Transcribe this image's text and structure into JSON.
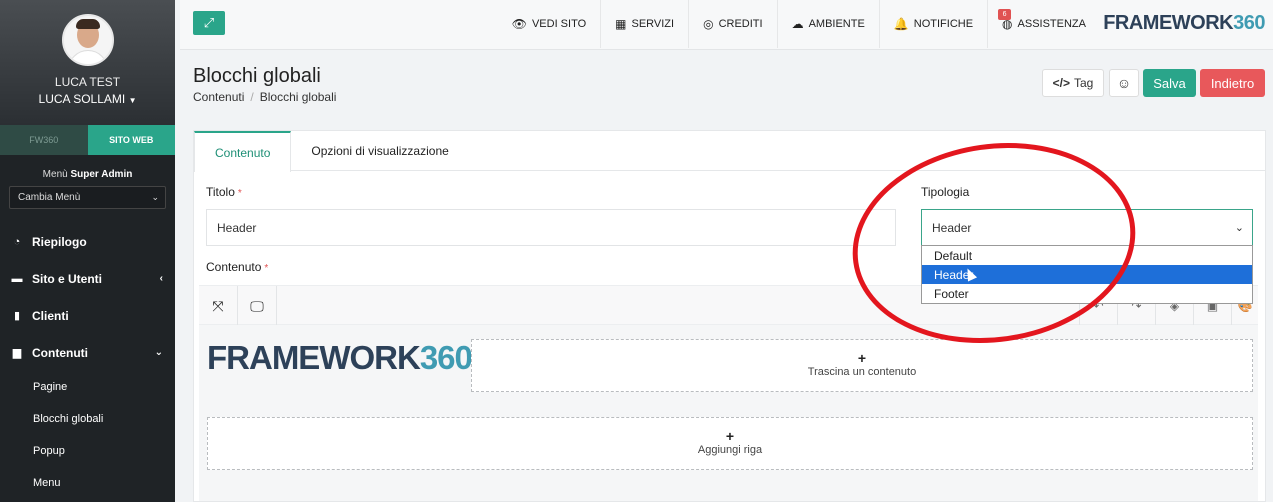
{
  "sidebar": {
    "user_first": "LUCA TEST",
    "user_second": "LUCA SOLLAMI",
    "tabs": [
      "FW360",
      "SITO WEB"
    ],
    "menu_prefix": "Menù",
    "menu_role": "Super Admin",
    "menu_select": "Cambia Menù",
    "items": [
      {
        "label": "Riepilogo",
        "icon": "dashboard-icon"
      },
      {
        "label": "Sito e Utenti",
        "icon": "users-icon"
      },
      {
        "label": "Clienti",
        "icon": "person-icon"
      },
      {
        "label": "Contenuti",
        "icon": "file-icon"
      }
    ],
    "subitems": [
      "Pagine",
      "Blocchi globali",
      "Popup",
      "Menu"
    ]
  },
  "topbar": {
    "nav": [
      {
        "label": "VEDI SITO",
        "icon": "eye-icon"
      },
      {
        "label": "SERVIZI",
        "icon": "building-icon"
      },
      {
        "label": "CREDITI",
        "icon": "coins-icon"
      },
      {
        "label": "AMBIENTE",
        "icon": "cloud-icon"
      },
      {
        "label": "NOTIFICHE",
        "icon": "bell-icon"
      },
      {
        "label": "ASSISTENZA",
        "icon": "globe-icon"
      }
    ],
    "badge": "6",
    "brand_a": "FRAMEWORK",
    "brand_b": "360"
  },
  "page": {
    "title": "Blocchi globali",
    "breadcrumb": [
      "Contenuti",
      "Blocchi globali"
    ],
    "btn_tag": "Tag",
    "btn_save": "Salva",
    "btn_back": "Indietro"
  },
  "form": {
    "tabs": [
      "Contenuto",
      "Opzioni di visualizzazione"
    ],
    "titolo_label": "Titolo",
    "titolo_value": "Header",
    "tipologia_label": "Tipologia",
    "tipologia_value": "Header",
    "options": [
      "Default",
      "Header",
      "Footer"
    ],
    "contenuto_label": "Contenuto",
    "drop_label": "Trascina un contenuto",
    "add_row_label": "Aggiungi riga",
    "logo_a": "FRAMEWORK",
    "logo_b": "360"
  },
  "colors": {
    "accent": "#2aa58a",
    "danger": "#e8585b",
    "annotation": "#e3161e"
  }
}
